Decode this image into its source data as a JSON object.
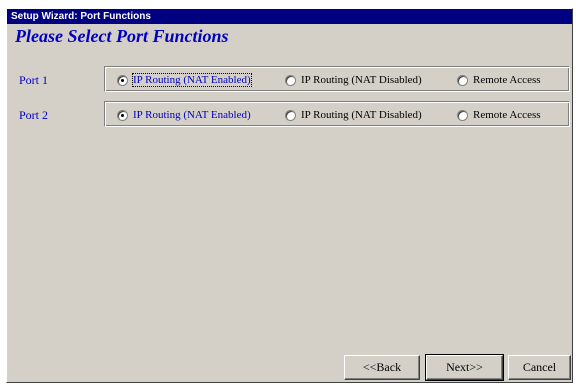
{
  "window": {
    "title": "Setup Wizard: Port Functions",
    "heading": "Please Select Port Functions"
  },
  "ports": [
    {
      "label": "Port  1",
      "options": [
        {
          "label": "IP Routing (NAT Enabled)",
          "selected": true
        },
        {
          "label": "IP Routing (NAT Disabled)",
          "selected": false
        },
        {
          "label": "Remote Access",
          "selected": false
        }
      ]
    },
    {
      "label": "Port  2",
      "options": [
        {
          "label": "IP Routing (NAT Enabled)",
          "selected": true
        },
        {
          "label": "IP Routing (NAT Disabled)",
          "selected": false
        },
        {
          "label": "Remote Access",
          "selected": false
        }
      ]
    }
  ],
  "buttons": {
    "back": "<<Back",
    "next": "Next>>",
    "cancel": "Cancel"
  },
  "colors": {
    "titlebar": "#000080",
    "accent_text": "#0000c0",
    "face": "#d4d0c8"
  }
}
